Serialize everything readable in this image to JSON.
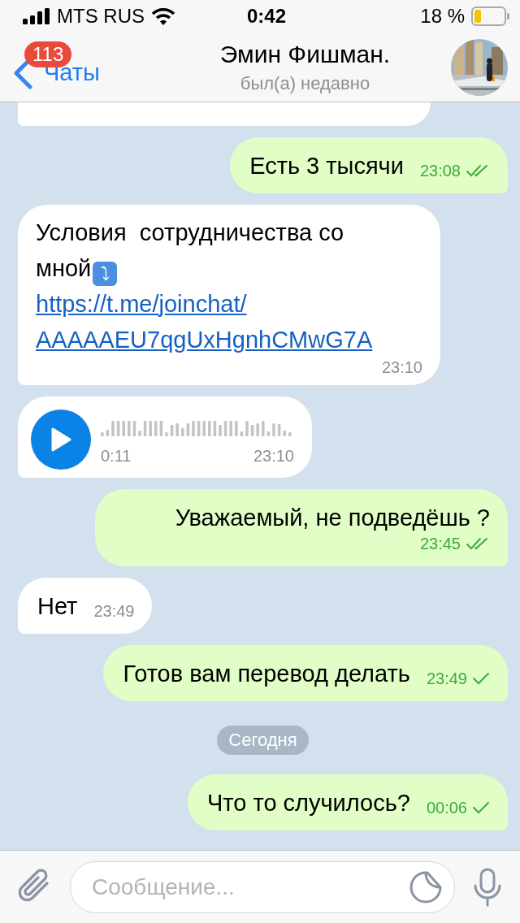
{
  "status_bar": {
    "carrier": "MTS RUS",
    "time": "0:42",
    "battery": "18 %"
  },
  "header": {
    "back": "Чаты",
    "unread_badge": "113",
    "title": "Эмин Фишман.",
    "subtitle": "был(а) недавно"
  },
  "messages": [
    {
      "kind": "clipped",
      "outgoing": false
    },
    {
      "kind": "text",
      "outgoing": true,
      "text": "Есть 3 тысячи",
      "time": "23:08",
      "read": true
    },
    {
      "kind": "link",
      "outgoing": false,
      "text": "Условия  сотрудничества со мной",
      "emoji": "⤵",
      "link": "https://t.me/joinchat/AAAAAEU7qgUxHgnhCMwG7A",
      "time": "23:10"
    },
    {
      "kind": "voice",
      "outgoing": false,
      "duration": "0:11",
      "time": "23:10"
    },
    {
      "kind": "text",
      "outgoing": true,
      "text": "Уважаемый, не подведёшь ?",
      "time": "23:45",
      "read": true
    },
    {
      "kind": "text",
      "outgoing": false,
      "text": "Нет",
      "time": "23:49"
    },
    {
      "kind": "text",
      "outgoing": true,
      "text": "Готов вам перевод делать",
      "time": "23:49",
      "read": false
    },
    {
      "kind": "date",
      "text": "Сегодня"
    },
    {
      "kind": "text",
      "outgoing": true,
      "text": "Что то случилось?",
      "time": "00:06",
      "read": false
    }
  ],
  "composer": {
    "placeholder": "Сообщение..."
  }
}
